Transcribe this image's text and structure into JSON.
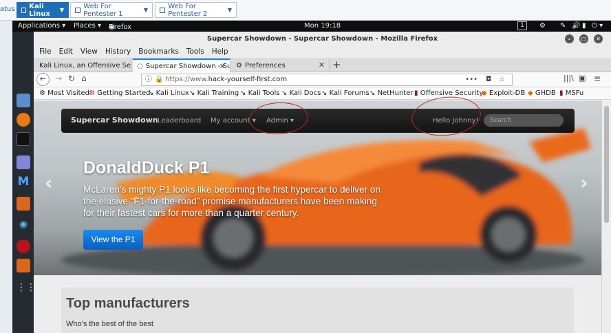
{
  "vm": {
    "status": "atus",
    "tabs": [
      {
        "label": "Kali Linux"
      },
      {
        "label": "Web For Pentester 1"
      },
      {
        "label": "Web For Pentester 2"
      }
    ]
  },
  "panel": {
    "applications": "Applications ▾",
    "places": "Places ▾",
    "firefox": "Firefox ESR ▾",
    "clock": "Mon 19:18",
    "workspace": "1"
  },
  "window": {
    "title": "Supercar Showdown - Supercar Showdown - Mozilla Firefox"
  },
  "menu": [
    "File",
    "Edit",
    "View",
    "History",
    "Bookmarks",
    "Tools",
    "Help"
  ],
  "tabs": [
    {
      "label": "Kali Linux, an Offensive Sec"
    },
    {
      "label": "Supercar Showdown - Su"
    },
    {
      "label": "Preferences"
    }
  ],
  "url": {
    "prefix": "https://www.",
    "host": "hack-yourself-first.com"
  },
  "bookmarks": [
    "Most Visited",
    "Getting Started",
    "Kali Linux",
    "Kali Training",
    "Kali Tools",
    "Kali Docs",
    "Kali Forums",
    "NetHunter",
    "Offensive Security",
    "Exploit-DB",
    "GHDB",
    "MSFu"
  ],
  "site": {
    "brand": "Supercar Showdown",
    "nav": {
      "leaderboard": "Leaderboard",
      "account": "My account ▾",
      "admin": "Admin ▾",
      "hello": "Hello Johnny!"
    },
    "search_placeholder": "Search",
    "hero": {
      "title": "DonaldDuck P1",
      "text": "McLaren’s mighty P1 looks like becoming the first hypercar to deliver on the elusive “F1-for-the-road” promise manufacturers have been making for their fastest cars for more than a quarter century.",
      "button": "View the P1"
    },
    "section": {
      "title": "Top manufacturers",
      "subtitle": "Who’s the best of the best"
    }
  },
  "colors": {
    "accent": "#1e6fb8",
    "annotation": "#c0262a",
    "hero_button": "#0a6fd6"
  }
}
